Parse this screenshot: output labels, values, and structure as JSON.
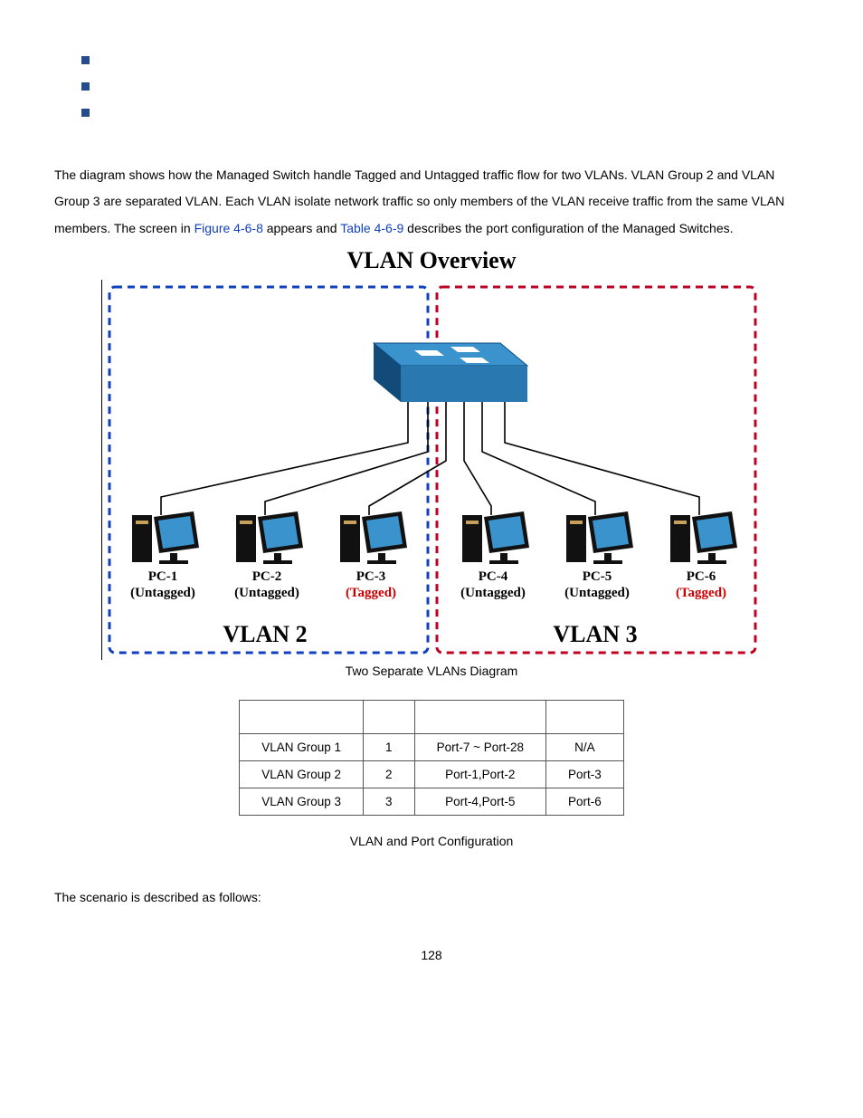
{
  "para": {
    "t1": "The diagram shows how the Managed Switch handle Tagged and Untagged traffic flow for two VLANs. VLAN Group 2 and VLAN Group 3 are separated VLAN. Each VLAN isolate network traffic so only members of the VLAN receive traffic from the same VLAN members. The screen in ",
    "link1": "Figure 4-6-8",
    "t2": " appears and ",
    "link2": "Table 4-6-9",
    "t3": " describes the port configuration of the Managed Switches."
  },
  "fig": {
    "title": "VLAN Overview",
    "caption": "Two Separate VLANs Diagram",
    "vlan2_label": "VLAN 2",
    "vlan3_label": "VLAN 3",
    "pcs": [
      {
        "name": "PC-1",
        "tag": "(Untagged)",
        "tagcolor": "#000"
      },
      {
        "name": "PC-2",
        "tag": "(Untagged)",
        "tagcolor": "#000"
      },
      {
        "name": "PC-3",
        "tag": "(Tagged)",
        "tagcolor": "#c00"
      },
      {
        "name": "PC-4",
        "tag": "(Untagged)",
        "tagcolor": "#000"
      },
      {
        "name": "PC-5",
        "tag": "(Untagged)",
        "tagcolor": "#000"
      },
      {
        "name": "PC-6",
        "tag": "(Tagged)",
        "tagcolor": "#c00"
      }
    ]
  },
  "table": {
    "caption": "VLAN and Port Configuration",
    "rows": [
      {
        "g": "VLAN Group 1",
        "id": "1",
        "un": "Port-7 ~ Port-28",
        "tg": "N/A"
      },
      {
        "g": "VLAN Group 2",
        "id": "2",
        "un": "Port-1,Port-2",
        "tg": "Port-3"
      },
      {
        "g": "VLAN Group 3",
        "id": "3",
        "un": "Port-4,Port-5",
        "tg": "Port-6"
      }
    ]
  },
  "closing": "The scenario is described as follows:",
  "page": "128"
}
